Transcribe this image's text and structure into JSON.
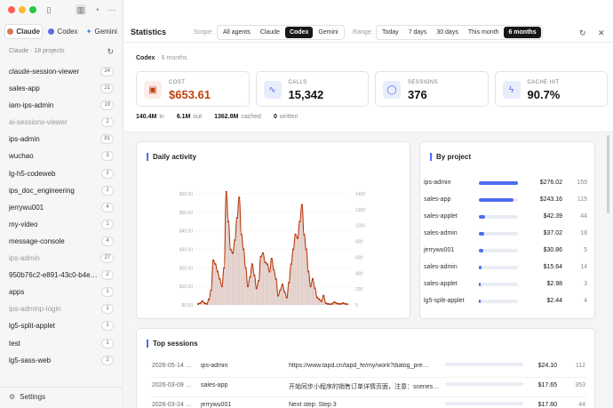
{
  "sidebar": {
    "agents": [
      {
        "label": "Claude",
        "color": "#d97757",
        "active": true
      },
      {
        "label": "Codex",
        "color": "#5b6ee1",
        "active": false
      },
      {
        "label": "Gemini",
        "color": "#3a7bf6",
        "active": false
      }
    ],
    "projects_heading": "Claude · 18 projects",
    "projects": [
      {
        "name": "claude-session-viewer",
        "count": "24",
        "muted": false
      },
      {
        "name": "sales-app",
        "count": "21",
        "muted": false
      },
      {
        "name": "iam-ips-admin",
        "count": "19",
        "muted": false
      },
      {
        "name": "ai-sessions-viewer",
        "count": "2",
        "muted": true
      },
      {
        "name": "ips-admin",
        "count": "81",
        "muted": false
      },
      {
        "name": "wuchao",
        "count": "3",
        "muted": false
      },
      {
        "name": "lg-h5-codeweb",
        "count": "2",
        "muted": false
      },
      {
        "name": "ips_doc_engineering",
        "count": "2",
        "muted": false
      },
      {
        "name": "jerrywu001",
        "count": "4",
        "muted": false
      },
      {
        "name": "my-video",
        "count": "1",
        "muted": false
      },
      {
        "name": "message-console",
        "count": "4",
        "muted": false
      },
      {
        "name": "ips-admin",
        "count": "27",
        "muted": true
      },
      {
        "name": "950b76c2-e891-43c0-b4e8…",
        "count": "2",
        "muted": false
      },
      {
        "name": "apps",
        "count": "1",
        "muted": false
      },
      {
        "name": "ips-adminp-login",
        "count": "1",
        "muted": true
      },
      {
        "name": "lg5-split-applet",
        "count": "1",
        "muted": false
      },
      {
        "name": "test",
        "count": "1",
        "muted": false
      },
      {
        "name": "lg5-sass-web",
        "count": "2",
        "muted": false
      }
    ],
    "settings_label": "Settings"
  },
  "header": {
    "title": "Statistics",
    "scope_label": "Scope:",
    "scope_options": [
      "All agents",
      "Claude",
      "Codex",
      "Gemini"
    ],
    "scope_selected": "Codex",
    "range_label": "Range:",
    "range_options": [
      "Today",
      "7 days",
      "30 days",
      "This month",
      "6 months"
    ],
    "range_selected": "6 months"
  },
  "summary": {
    "agent": "Codex",
    "period": "· 6 months",
    "cards": [
      {
        "label": "COST",
        "value": "$653.61",
        "color": "#c2410c",
        "bg": "#fdecea",
        "icon": "wallet-icon",
        "glyph": "▣"
      },
      {
        "label": "CALLS",
        "value": "15,342",
        "color": "#111111",
        "bg": "#e8edfb",
        "icon": "activity-icon",
        "glyph": "∿"
      },
      {
        "label": "SESSIONS",
        "value": "376",
        "color": "#111111",
        "bg": "#e8edfb",
        "icon": "chat-icon",
        "glyph": "◯"
      },
      {
        "label": "CACHE HIT",
        "value": "90.7%",
        "color": "#111111",
        "bg": "#e8edfb",
        "icon": "bolt-icon",
        "glyph": "ϟ"
      }
    ],
    "tokens": [
      {
        "value": "140.4M",
        "label": "in"
      },
      {
        "value": "6.1M",
        "label": "out"
      },
      {
        "value": "1362.8M",
        "label": "cached"
      },
      {
        "value": "0",
        "label": "written"
      }
    ]
  },
  "daily_activity": {
    "title": "Daily activity"
  },
  "chart_data": {
    "type": "line",
    "title": "Daily activity",
    "left_axis_ticks": [
      "$0.00",
      "$10.00",
      "$20.00",
      "$30.00",
      "$40.00",
      "$50.00",
      "$60.00"
    ],
    "right_axis_ticks": [
      "0",
      "200",
      "400",
      "600",
      "800",
      "1000",
      "1200",
      "1400"
    ],
    "ylim_cost": [
      0,
      60
    ],
    "ylim_calls": [
      0,
      1400
    ],
    "grid": true,
    "series": [
      {
        "values": [
          0.5,
          1,
          2,
          1,
          0.5,
          3,
          8,
          24,
          22,
          18,
          14,
          10,
          20,
          61,
          45,
          30,
          28,
          35,
          47,
          58,
          38,
          30,
          20,
          10,
          15,
          22,
          16,
          9,
          13,
          26,
          28,
          23,
          22,
          18,
          25,
          19,
          14,
          5,
          8,
          11,
          7,
          4,
          12,
          22,
          30,
          38,
          36,
          45,
          54,
          38,
          30,
          18,
          10,
          14,
          9,
          4,
          3,
          2,
          5,
          1,
          0.5,
          0.4,
          0.6,
          1.5,
          0.8,
          0.6,
          0.5,
          1,
          0.6,
          0.4
        ]
      }
    ]
  },
  "by_project": {
    "title": "By project",
    "rows": [
      {
        "name": "ips-admin",
        "cost": "$276.02",
        "count": "159",
        "share": 1.0
      },
      {
        "name": "sales-app",
        "cost": "$243.16",
        "count": "115",
        "share": 0.88
      },
      {
        "name": "sales-applet",
        "cost": "$42.39",
        "count": "44",
        "share": 0.15
      },
      {
        "name": "sales-admin",
        "cost": "$37.02",
        "count": "18",
        "share": 0.13
      },
      {
        "name": "jerrywu001",
        "cost": "$30.86",
        "count": "5",
        "share": 0.11
      },
      {
        "name": "sales-admin",
        "cost": "$15.64",
        "count": "14",
        "share": 0.06
      },
      {
        "name": "sales-applet",
        "cost": "$2.98",
        "count": "3",
        "share": 0.011
      },
      {
        "name": "lg5-split-applet",
        "cost": "$2.44",
        "count": "4",
        "share": 0.009
      }
    ]
  },
  "top_sessions": {
    "title": "Top sessions",
    "rows": [
      {
        "date": "2026-05-14 …",
        "project": "ips-admin",
        "message": "https://www.tapd.cn/tapd_fe/my/work?dialog_pre…",
        "cost": "$24.10",
        "count": "112",
        "share": 1.0
      },
      {
        "date": "2026-03-09 …",
        "project": "sales-app",
        "message": "开始同步小程序的销售订单详情页面，注意：scenes…",
        "cost": "$17.65",
        "count": "353",
        "share": 0.73
      },
      {
        "date": "2026-03-24 …",
        "project": "jerrywu001",
        "message": "Next step: Step 3",
        "cost": "$17.60",
        "count": "44",
        "share": 0.73
      }
    ]
  }
}
